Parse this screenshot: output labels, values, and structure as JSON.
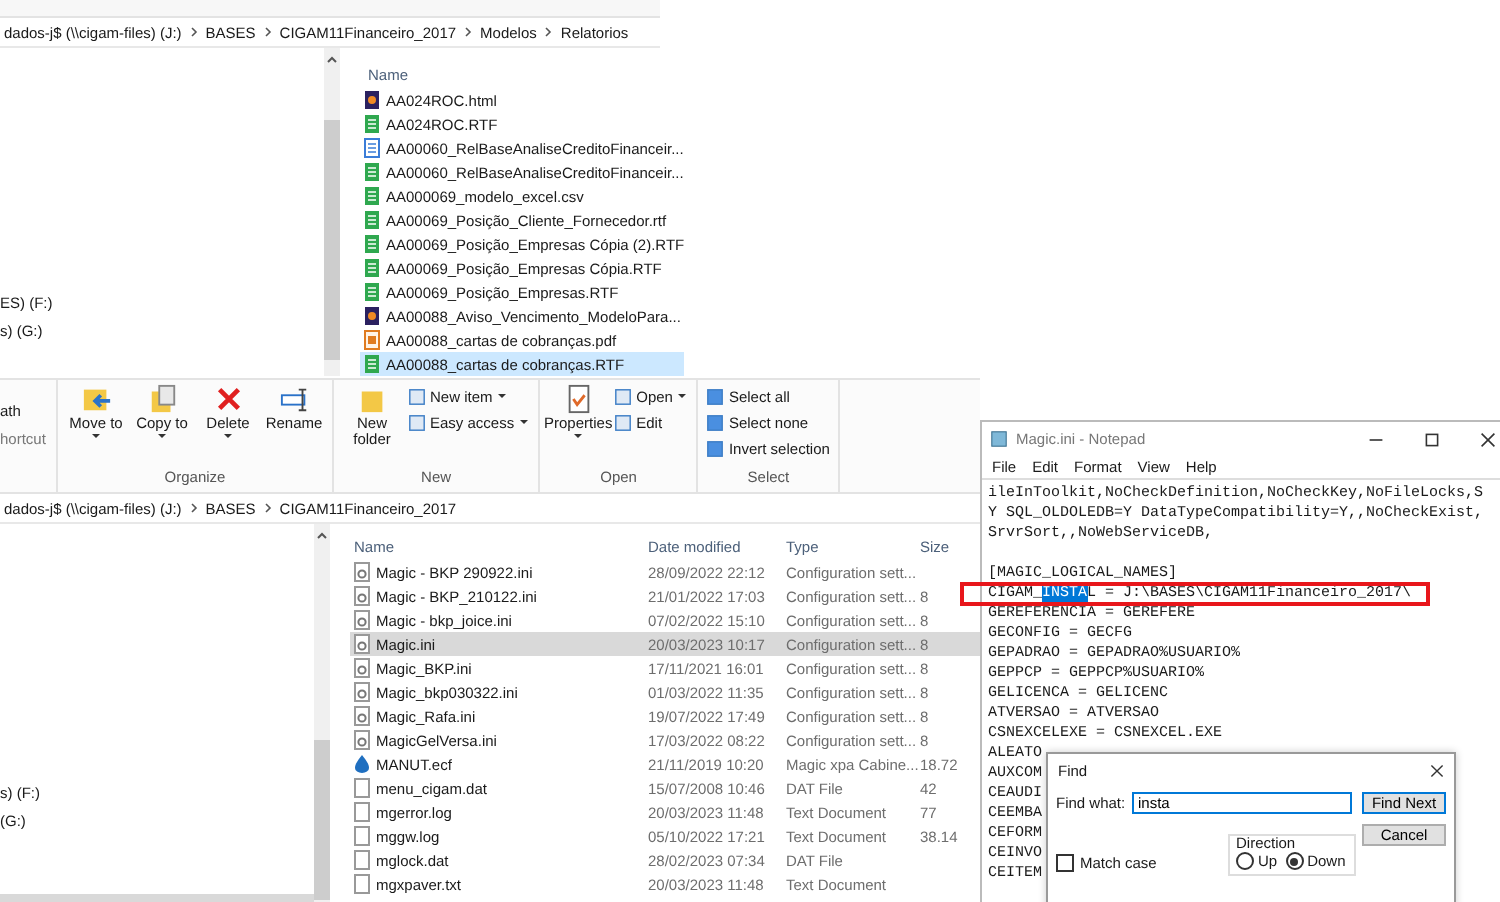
{
  "explorer_top": {
    "breadcrumb": [
      "dados-j$ (\\\\cigam-files) (J:)",
      "BASES",
      "CIGAM11Financeiro_2017",
      "Modelos",
      "Relatorios"
    ],
    "nav_items": [
      "ES) (F:)",
      "s) (G:)"
    ],
    "name_column": "Name",
    "files": [
      {
        "name": "AA024ROC.html",
        "kind": "html",
        "selected": false
      },
      {
        "name": "AA024ROC.RTF",
        "kind": "rtf",
        "selected": false
      },
      {
        "name": "AA00060_RelBaseAnaliseCreditoFinanceir...",
        "kind": "doc",
        "selected": false
      },
      {
        "name": "AA00060_RelBaseAnaliseCreditoFinanceir...",
        "kind": "rtf",
        "selected": false
      },
      {
        "name": "AA000069_modelo_excel.csv",
        "kind": "rtf",
        "selected": false
      },
      {
        "name": "AA00069_Posição_Cliente_Fornecedor.rtf",
        "kind": "rtf",
        "selected": false
      },
      {
        "name": "AA00069_Posição_Empresas Cópia (2).RTF",
        "kind": "rtf",
        "selected": false
      },
      {
        "name": "AA00069_Posição_Empresas Cópia.RTF",
        "kind": "rtf",
        "selected": false
      },
      {
        "name": "AA00069_Posição_Empresas.RTF",
        "kind": "rtf",
        "selected": false
      },
      {
        "name": "AA00088_Aviso_Vencimento_ModeloPara...",
        "kind": "html",
        "selected": false
      },
      {
        "name": "AA00088_cartas de cobranças.pdf",
        "kind": "pdf",
        "selected": false
      },
      {
        "name": "AA00088_cartas de cobranças.RTF",
        "kind": "rtf",
        "selected": true
      }
    ]
  },
  "ribbon": {
    "cut_labels": [
      "ath",
      "hortcut"
    ],
    "groups": [
      {
        "label": "Organize",
        "items": [
          {
            "label": "Move to",
            "kind": "large",
            "dropdown": true
          },
          {
            "label": "Copy to",
            "kind": "large",
            "dropdown": true
          },
          {
            "label": "Delete",
            "kind": "large",
            "dropdown": true
          },
          {
            "label": "Rename",
            "kind": "large",
            "dropdown": false
          }
        ]
      },
      {
        "label": "New",
        "items": [
          {
            "label": "New folder",
            "kind": "large",
            "dropdown": false
          },
          {
            "label": "New item",
            "kind": "small",
            "dropdown": true
          },
          {
            "label": "Easy access",
            "kind": "small",
            "dropdown": true
          }
        ]
      },
      {
        "label": "Open",
        "items": [
          {
            "label": "Properties",
            "kind": "large",
            "dropdown": true
          },
          {
            "label": "Open",
            "kind": "small",
            "dropdown": true
          },
          {
            "label": "Edit",
            "kind": "small",
            "dropdown": false
          }
        ]
      },
      {
        "label": "Select",
        "items": [
          {
            "label": "Select all",
            "kind": "small",
            "dropdown": false
          },
          {
            "label": "Select none",
            "kind": "small",
            "dropdown": false
          },
          {
            "label": "Invert selection",
            "kind": "small",
            "dropdown": false
          }
        ]
      }
    ]
  },
  "explorer_bottom": {
    "breadcrumb": [
      "dados-j$ (\\\\cigam-files) (J:)",
      "BASES",
      "CIGAM11Financeiro_2017"
    ],
    "nav_items": [
      "s) (F:)",
      "(G:)"
    ],
    "columns": [
      "Name",
      "Date modified",
      "Type",
      "Size"
    ],
    "files": [
      {
        "name": "Magic - BKP 290922.ini",
        "date": "28/09/2022 22:12",
        "type": "Configuration sett...",
        "kind": "ini",
        "selected": false
      },
      {
        "name": "Magic - BKP_210122.ini",
        "date": "21/01/2022 17:03",
        "type": "Configuration sett...",
        "size": "8",
        "kind": "ini",
        "selected": false
      },
      {
        "name": "Magic - bkp_joice.ini",
        "date": "07/02/2022 15:10",
        "type": "Configuration sett...",
        "size": "8",
        "kind": "ini",
        "selected": false
      },
      {
        "name": "Magic.ini",
        "date": "20/03/2023 10:17",
        "type": "Configuration sett...",
        "size": "8",
        "kind": "ini",
        "selected": true
      },
      {
        "name": "Magic_BKP.ini",
        "date": "17/11/2021 16:01",
        "type": "Configuration sett...",
        "size": "8",
        "kind": "ini",
        "selected": false
      },
      {
        "name": "Magic_bkp030322.ini",
        "date": "01/03/2022 11:35",
        "type": "Configuration sett...",
        "size": "8",
        "kind": "ini",
        "selected": false
      },
      {
        "name": "Magic_Rafa.ini",
        "date": "19/07/2022 17:49",
        "type": "Configuration sett...",
        "size": "8",
        "kind": "ini",
        "selected": false
      },
      {
        "name": "MagicGelVersa.ini",
        "date": "17/03/2022 08:22",
        "type": "Configuration sett...",
        "size": "8",
        "kind": "ini",
        "selected": false
      },
      {
        "name": "MANUT.ecf",
        "date": "21/11/2019 10:20",
        "type": "Magic xpa Cabine...",
        "size": "18.72",
        "kind": "ecf",
        "selected": false
      },
      {
        "name": "menu_cigam.dat",
        "date": "15/07/2008 10:46",
        "type": "DAT File",
        "size": "42",
        "kind": "dat",
        "selected": false
      },
      {
        "name": "mgerror.log",
        "date": "20/03/2023 11:48",
        "type": "Text Document",
        "size": "77",
        "kind": "dat",
        "selected": false
      },
      {
        "name": "mggw.log",
        "date": "05/10/2022 17:21",
        "type": "Text Document",
        "size": "38.14",
        "kind": "dat",
        "selected": false
      },
      {
        "name": "mglock.dat",
        "date": "28/02/2023 07:34",
        "type": "DAT File",
        "kind": "dat",
        "selected": false
      },
      {
        "name": "mgxpaver.txt",
        "date": "20/03/2023 11:48",
        "type": "Text Document",
        "kind": "dat",
        "selected": false
      }
    ]
  },
  "notepad": {
    "title": "Magic.ini - Notepad",
    "menu": [
      "File",
      "Edit",
      "Format",
      "View",
      "Help"
    ],
    "lines": [
      {
        "kind": "text",
        "text": "ileInToolkit,NoCheckDefinition,NoCheckKey,NoFileLocks,S"
      },
      {
        "kind": "text",
        "text": "Y SQL_OLDOLEDB=Y DataTypeCompatibility=Y,,NoCheckExist,"
      },
      {
        "kind": "text",
        "text": "SrvrSort,,NoWebServiceDB,"
      },
      {
        "kind": "blank"
      },
      {
        "kind": "text",
        "text": "[MAGIC_LOGICAL_NAMES]"
      },
      {
        "kind": "match",
        "text": "CIGAM_",
        "selected_text": "INSTA",
        "text_after": "L = J:\\BASES\\CIGAM11Financeiro_2017\\"
      },
      {
        "kind": "text",
        "text": "GEREFERENCIA = GEREFERE"
      },
      {
        "kind": "text",
        "text": "GECONFIG = GECFG"
      },
      {
        "kind": "text",
        "text": "GEPADRAO = GEPADRAO%USUARIO%"
      },
      {
        "kind": "text",
        "text": "GEPPCP = GEPPCP%USUARIO%"
      },
      {
        "kind": "text",
        "text": "GELICENCA = GELICENC"
      },
      {
        "kind": "text",
        "text": "ATVERSAO = ATVERSAO"
      },
      {
        "kind": "text",
        "text": "CSNEXCELEXE = CSNEXCEL.EXE"
      },
      {
        "kind": "text",
        "text": "ALEATO"
      },
      {
        "kind": "text",
        "text": "AUXCOM"
      },
      {
        "kind": "text",
        "text": "CEAUDI"
      },
      {
        "kind": "text",
        "text": "CEEMBA"
      },
      {
        "kind": "text",
        "text": "CEFORM"
      },
      {
        "kind": "text",
        "text": "CEINVO"
      },
      {
        "kind": "text",
        "text": "CEITEM"
      }
    ]
  },
  "find_dialog": {
    "title": "Find",
    "find_what_label": "Find what:",
    "value": "insta",
    "buttons": [
      "Find Next",
      "Cancel"
    ],
    "direction": {
      "label": "Direction",
      "options": [
        {
          "label": "Up",
          "selected": false
        },
        {
          "label": "Down",
          "selected": true
        }
      ]
    },
    "match_case": {
      "label": "Match case",
      "checked": false
    }
  }
}
